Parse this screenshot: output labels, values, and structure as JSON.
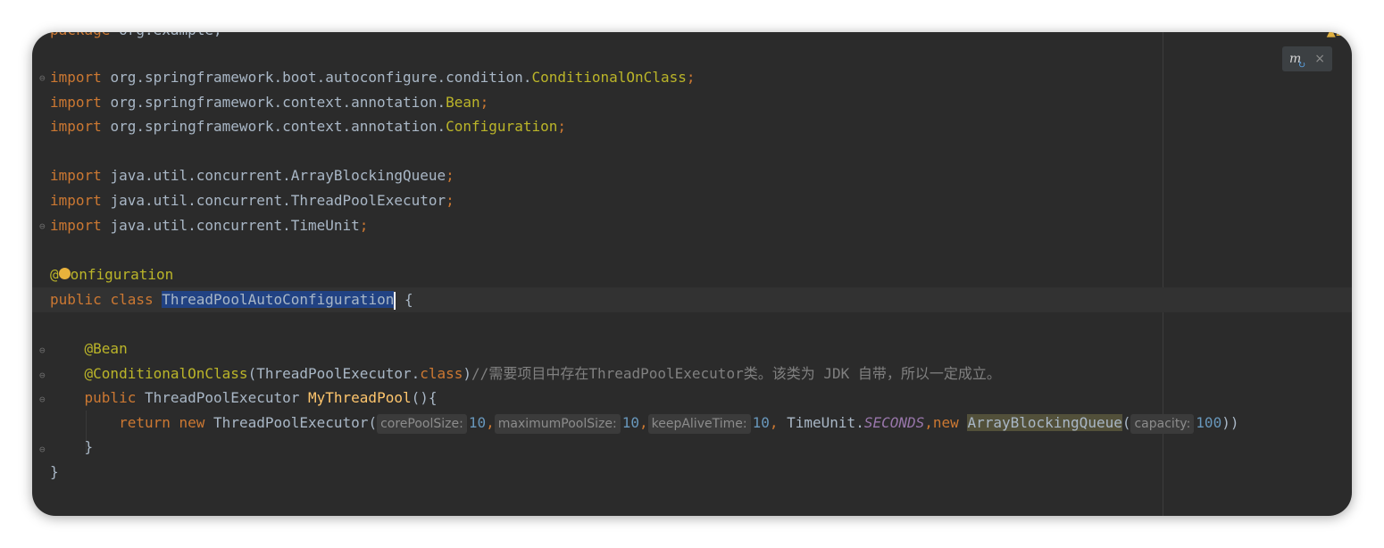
{
  "editor": {
    "top_cut_line": "package org.example;",
    "warning_count": "2",
    "plugin_close": "×",
    "imports": [
      {
        "kw": "import",
        "pkg": "org.springframework.boot.autoconfigure.condition.",
        "cls": "ConditionalOnClass",
        "end": ";"
      },
      {
        "kw": "import",
        "pkg": "org.springframework.context.annotation.",
        "cls": "Bean",
        "end": ";"
      },
      {
        "kw": "import",
        "pkg": "org.springframework.context.annotation.",
        "cls": "Configuration",
        "end": ";"
      },
      {
        "kw": "import",
        "pkg": "java.util.concurrent.ArrayBlockingQueue",
        "cls": "",
        "end": ";"
      },
      {
        "kw": "import",
        "pkg": "java.util.concurrent.ThreadPoolExecutor",
        "cls": "",
        "end": ";"
      },
      {
        "kw": "import",
        "pkg": "java.util.concurrent.TimeUnit",
        "cls": "",
        "end": ";"
      }
    ],
    "class_annotation_at": "@",
    "class_annotation_rest": "onfiguration",
    "class_decl": {
      "kw1": "public",
      "kw2": "class",
      "name": "ThreadPoolAutoConfiguration",
      "brace": " {"
    },
    "bean_annotation": "@Bean",
    "conditional": {
      "ann": "@ConditionalOnClass",
      "open": "(",
      "arg": "ThreadPoolExecutor.",
      "arg_kw": "class",
      "close": ")",
      "comment": "//需要项目中存在ThreadPoolExecutor类。该类为 JDK 自带，所以一定成立。"
    },
    "method": {
      "kw": "public",
      "type": "ThreadPoolExecutor",
      "name": "MyThreadPool",
      "rest": "(){"
    },
    "return_line": {
      "kw1": "return",
      "kw2": "new",
      "type": "ThreadPoolExecutor",
      "open": "(",
      "hint1": "corePoolSize:",
      "val1": "10",
      "hint2": "maximumPoolSize:",
      "val2": "10",
      "hint3": "keepAliveTime:",
      "val3": "10",
      "unit": "TimeUnit.",
      "unit_const": "SECONDS",
      "kw3": "new",
      "queue": "ArrayBlockingQueue",
      "qopen": "(",
      "hint4": "capacity:",
      "val4": "100",
      "close": "))"
    },
    "method_close": "}",
    "class_close": "}"
  }
}
